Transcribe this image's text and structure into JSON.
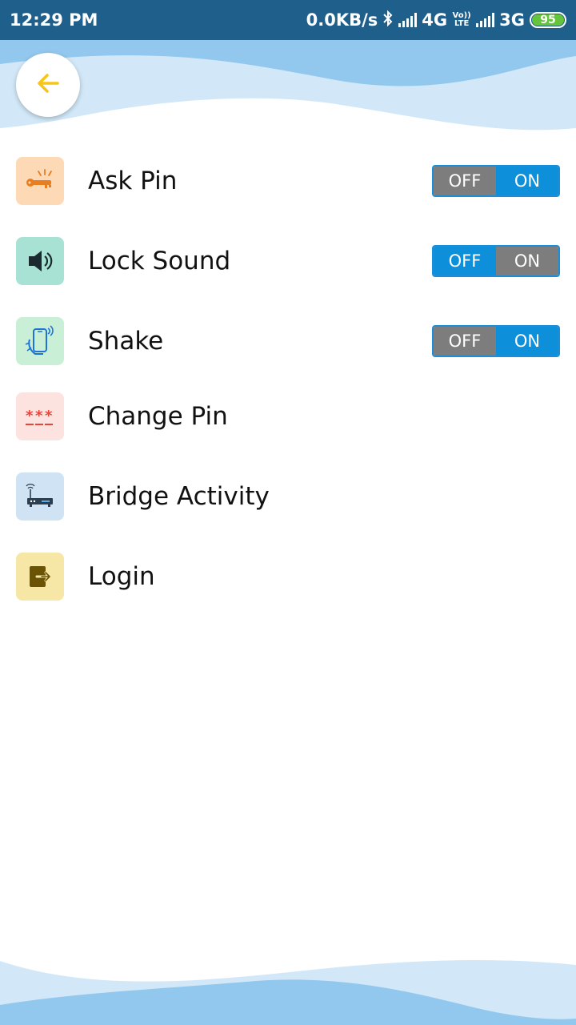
{
  "status_bar": {
    "time": "12:29 PM",
    "speed": "0.0KB/s",
    "network_1": "4G",
    "volte": "Vo)) LTE",
    "network_2": "3G",
    "battery": "95"
  },
  "header": {
    "back_icon": "arrow-left-icon"
  },
  "settings": [
    {
      "label": "Ask Pin",
      "icon": "key-icon",
      "toggle": {
        "off": "OFF",
        "on": "ON",
        "state": "on"
      }
    },
    {
      "label": "Lock Sound",
      "icon": "speaker-icon",
      "toggle": {
        "off": "OFF",
        "on": "ON",
        "state": "off"
      }
    },
    {
      "label": "Shake",
      "icon": "phone-shake-icon",
      "toggle": {
        "off": "OFF",
        "on": "ON",
        "state": "on"
      }
    },
    {
      "label": "Change Pin",
      "icon": "password-icon"
    },
    {
      "label": "Bridge Activity",
      "icon": "router-icon"
    },
    {
      "label": "Login",
      "icon": "login-icon"
    }
  ],
  "colors": {
    "status_bar": "#1f5f8b",
    "wave_light": "#d2e8f8",
    "wave_dark": "#92c8ee",
    "back_arrow": "#f5c518",
    "toggle_active": "#0e8fda",
    "toggle_inactive": "#7d7d7d"
  }
}
